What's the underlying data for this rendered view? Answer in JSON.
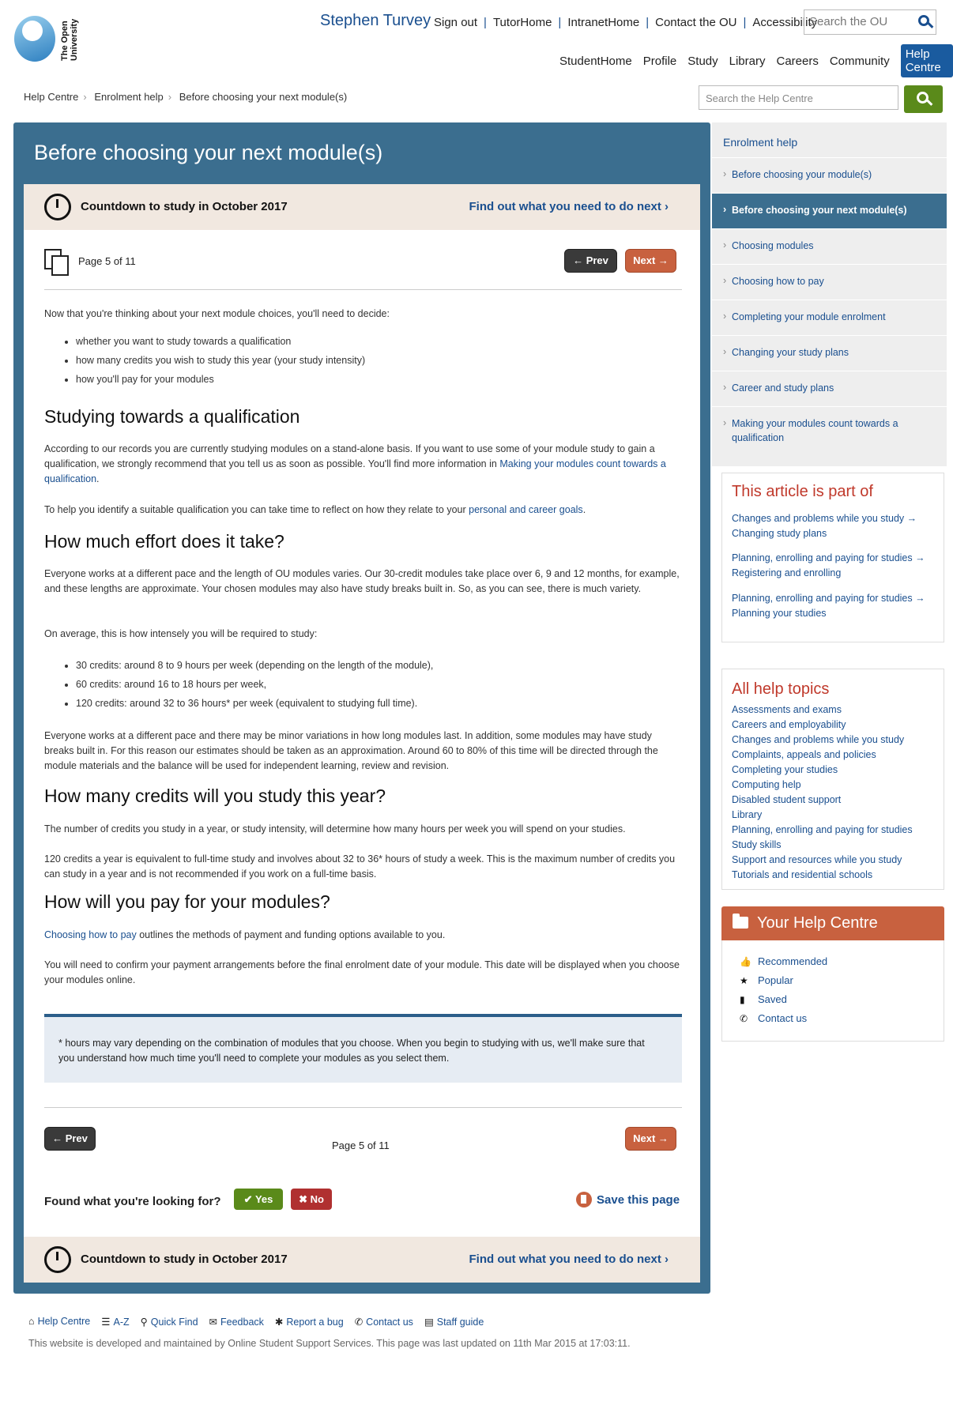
{
  "header": {
    "logo_text": "The Open University",
    "user_name": "Stephen Turvey",
    "top_links": [
      "Sign out",
      "TutorHome",
      "IntranetHome",
      "Contact the OU",
      "Accessibility"
    ],
    "search_placeholder": "Search the OU",
    "main_nav": [
      "StudentHome",
      "Profile",
      "Study",
      "Library",
      "Careers",
      "Community",
      "Help Centre"
    ]
  },
  "breadcrumb": [
    "Help Centre",
    "Enrolment help",
    "Before choosing your next module(s)"
  ],
  "hc_search_placeholder": "Search the Help Centre",
  "page_title": "Before choosing your next module(s)",
  "countdown": {
    "label": "Countdown to study in October 2017",
    "link": "Find out what you need to do next"
  },
  "pager": {
    "page_text": "Page 5 of 11",
    "prev": "Prev",
    "next": "Next"
  },
  "article": {
    "intro": "Now that you're thinking about your next module choices, you'll need to decide:",
    "decide_list": [
      "whether you want to study towards a qualification",
      "how many credits you wish to study this year (your study intensity)",
      "how you'll pay for your modules"
    ],
    "h_qualification": "Studying towards a qualification",
    "qual_p1": "According to our records you are currently studying modules on a stand-alone basis. If you want to use some of your module study to gain a qualification, we strongly recommend that you tell us as soon as possible. You'll find more information in",
    "qual_p1_link": "Making your modules count towards a qualification",
    "qual_p2": "To help you identify a suitable qualification you can take time to reflect on how they relate to your",
    "qual_p2_link": "personal and career goals",
    "h_effort": "How much effort does it take?",
    "effort_p1": "Everyone works at a different pace and the length of OU modules varies. Our 30-credit modules take place over 6, 9 and 12 months, for example, and these lengths are approximate. Your chosen modules may also have study breaks built in. So, as you can see, there is much variety.",
    "effort_p2": "On average, this is how intensely you will be required to study:",
    "effort_list": [
      "30 credits: around 8 to 9 hours per week (depending on the length of the module),",
      "60 credits: around 16 to 18 hours per week,",
      "120 credits: around 32 to 36 hours* per week (equivalent to studying full time)."
    ],
    "effort_p3": "Everyone works at a different pace and there may be minor variations in how long modules last. In addition, some modules may have study breaks built in. For this reason our estimates should be taken as an approximation. Around 60 to 80% of this time will be directed through the module materials and the balance will be used for independent learning, review and revision.",
    "h_credits": "How many credits will you study this year?",
    "credits_p1": "The number of credits you study in a year, or study intensity, will determine how many hours per week you will spend on your studies.",
    "credits_p2": "120 credits a year is equivalent to full-time study and involves about 32 to 36* hours of study a week. This is the maximum number of credits you can study in a year and is not recommended if you work on a full-time basis.",
    "h_pay": "How will you pay for your modules?",
    "pay_link": "Choosing how to pay",
    "pay_p1": "outlines the methods of payment and funding options available to you.",
    "pay_p2": "You will need to confirm your payment arrangements before the final enrolment date of your module. This date will be displayed when you choose your modules online.",
    "note": "* hours may vary depending on the combination of modules that you choose. When you begin to studying with us, we'll make sure that you understand how much time you'll need to complete your modules as you select them."
  },
  "feedback": {
    "question": "Found what you're looking for?",
    "yes": "Yes",
    "no": "No",
    "save": "Save this page"
  },
  "sidebar": {
    "heading": "Enrolment help",
    "items": [
      "Before choosing your module(s)",
      "Before choosing your next module(s)",
      "Choosing modules",
      "Choosing how to pay",
      "Completing your module enrolment",
      "Changing your study plans",
      "Career and study plans",
      "Making your modules count towards a qualification"
    ],
    "part_of_title": "This article is part of",
    "part_of": [
      "Changes and problems while you study → Changing study plans",
      "Planning, enrolling and paying for studies → Registering and enrolling",
      "Planning, enrolling and paying for studies → Planning your studies"
    ],
    "topics_title": "All help topics",
    "topics": [
      "Assessments and exams",
      "Careers and employability",
      "Changes and problems while you study",
      "Complaints, appeals and policies",
      "Completing your studies",
      "Computing help",
      "Disabled student support",
      "Library",
      "Planning, enrolling and paying for studies",
      "Study skills",
      "Support and resources while you study",
      "Tutorials and residential schools"
    ],
    "yhc_title": "Your Help Centre",
    "yhc_items": [
      "Recommended",
      "Popular",
      "Saved",
      "Contact us"
    ]
  },
  "footer": {
    "links": [
      "Help Centre",
      "A-Z",
      "Quick Find",
      "Feedback",
      "Report a bug",
      "Contact us",
      "Staff guide"
    ],
    "text": "This website is developed and maintained by Online Student Support Services. This page was last updated on 11th Mar 2015 at 17:03:11."
  },
  "colors": {
    "brand_blue": "#1a4f8f",
    "panel_blue": "#3b6e8f",
    "accent_orange": "#c8613f",
    "green": "#5a8a1a",
    "red": "#b03030"
  }
}
